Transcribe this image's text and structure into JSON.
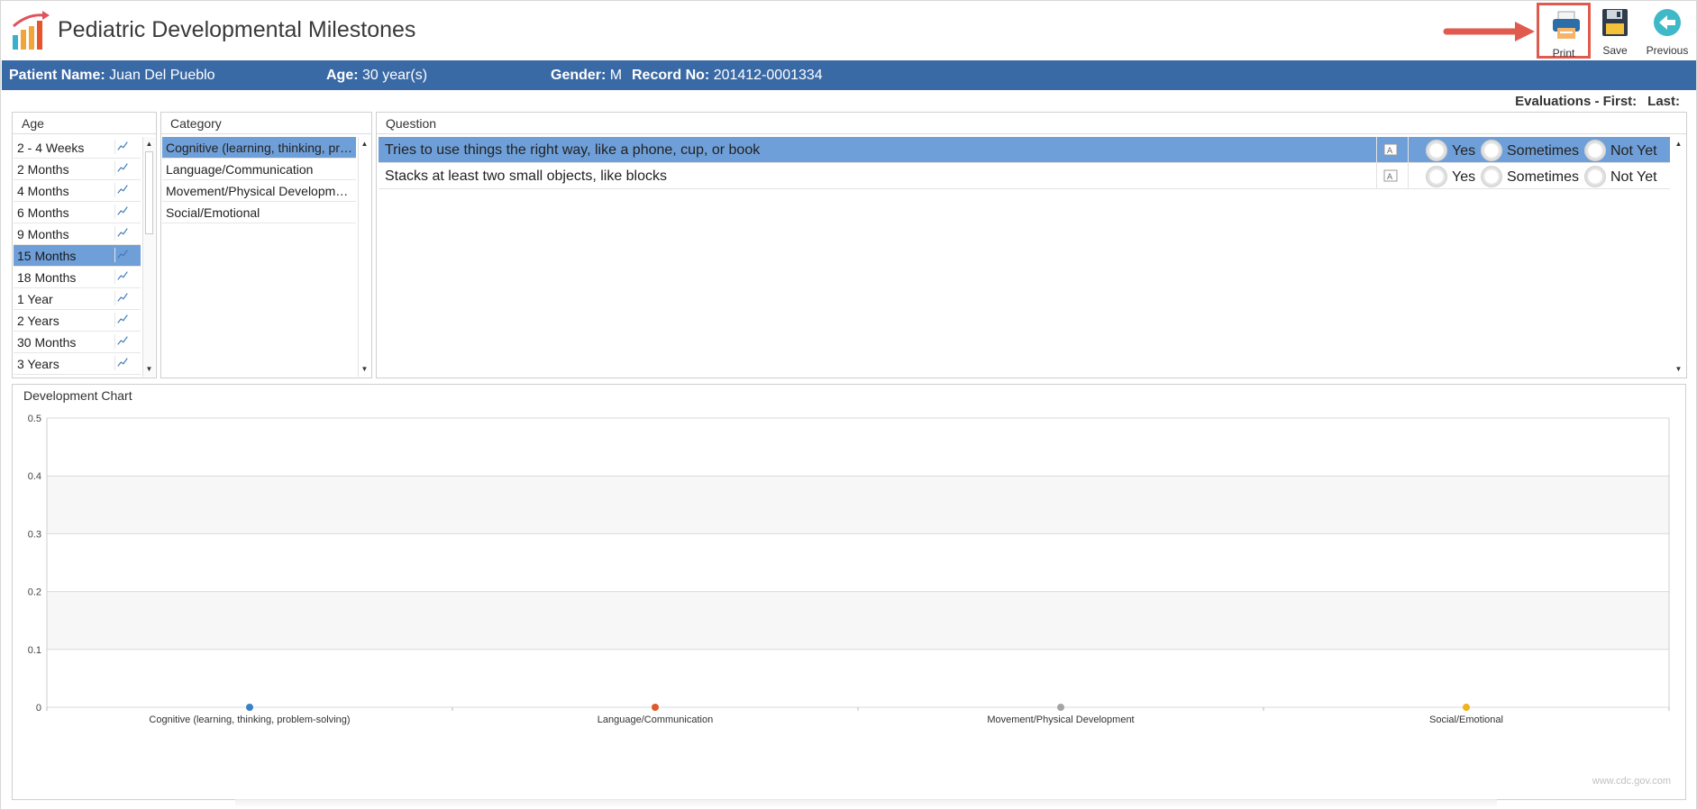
{
  "app": {
    "title": "Pediatric Developmental Milestones"
  },
  "toolbar": {
    "print_label": "Print",
    "save_label": "Save",
    "previous_label": "Previous"
  },
  "patient": {
    "name_label": "Patient Name:",
    "name": "Juan Del Pueblo",
    "age_label": "Age:",
    "age": "30 year(s)",
    "gender_label": "Gender:",
    "gender": "M",
    "record_label": "Record No:",
    "record": "201412-0001334"
  },
  "evaluations": {
    "label": "Evaluations - First:",
    "last_label": "Last:"
  },
  "age_panel": {
    "header": "Age",
    "items": [
      {
        "label": "2 - 4 Weeks"
      },
      {
        "label": "2 Months"
      },
      {
        "label": "4 Months"
      },
      {
        "label": "6 Months"
      },
      {
        "label": "9 Months"
      },
      {
        "label": "15 Months"
      },
      {
        "label": "18 Months"
      },
      {
        "label": "1 Year"
      },
      {
        "label": "2 Years"
      },
      {
        "label": "30 Months"
      },
      {
        "label": "3 Years"
      }
    ],
    "selected_index": 5
  },
  "category_panel": {
    "header": "Category",
    "items": [
      {
        "label": "Cognitive (learning, thinking, problem-solving)"
      },
      {
        "label": "Language/Communication"
      },
      {
        "label": "Movement/Physical Development"
      },
      {
        "label": "Social/Emotional"
      }
    ],
    "selected_index": 0
  },
  "question_panel": {
    "header": "Question",
    "options": {
      "yes": "Yes",
      "sometimes": "Sometimes",
      "not_yet": "Not Yet"
    },
    "questions": [
      {
        "text": "Tries to use things the right way, like a phone, cup, or book"
      },
      {
        "text": "Stacks at least two small objects, like blocks"
      }
    ],
    "selected_index": 0
  },
  "chart_panel": {
    "header": "Development Chart",
    "watermark": "www.cdc.gov.com"
  },
  "chart_data": {
    "type": "line",
    "categories": [
      "Cognitive (learning, thinking, problem-solving)",
      "Language/Communication",
      "Movement/Physical Development",
      "Social/Emotional"
    ],
    "series": [
      {
        "values": [
          0,
          0,
          0,
          0
        ]
      }
    ],
    "point_colors": [
      "#3b80c4",
      "#e0592a",
      "#a5a5a5",
      "#f0b21d"
    ],
    "yticks": [
      "0",
      "0.1",
      "0.2",
      "0.3",
      "0.4",
      "0.5"
    ],
    "ylim": [
      0,
      0.5
    ],
    "grid": true
  },
  "colors": {
    "header_bar": "#3a6aa6",
    "selection": "#6f9fd8",
    "highlight_border": "#e05a4e"
  }
}
